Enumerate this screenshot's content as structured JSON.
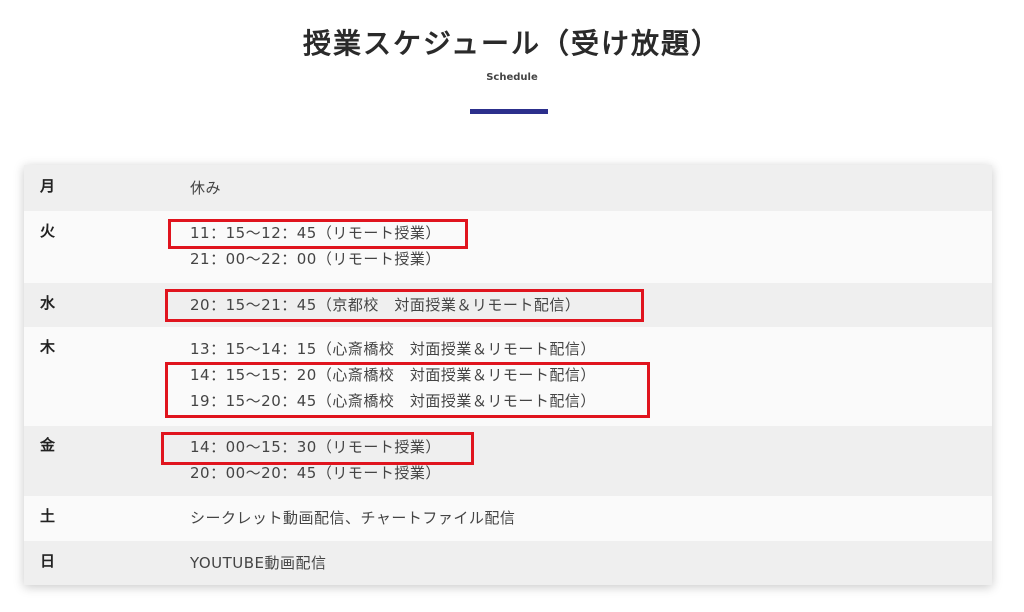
{
  "header": {
    "title": "授業スケジュール（受け放題）",
    "subtitle": "Schedule",
    "accent_color": "#2c2f8c",
    "highlight_color": "#e0141e"
  },
  "schedule": {
    "rows": [
      {
        "day": "月",
        "entries": [
          "休み"
        ],
        "highlighted": [
          false
        ]
      },
      {
        "day": "火",
        "entries": [
          "11：15〜12：45（リモート授業）",
          "21：00〜22：00（リモート授業）"
        ],
        "highlighted": [
          true,
          false
        ]
      },
      {
        "day": "水",
        "entries": [
          "20：15〜21：45（京都校　対面授業＆リモート配信）"
        ],
        "highlighted": [
          true
        ]
      },
      {
        "day": "木",
        "entries": [
          "13：15〜14：15（心斎橋校　対面授業＆リモート配信）",
          "14：15〜15：20（心斎橋校　対面授業＆リモート配信）",
          "19：15〜20：45（心斎橋校　対面授業＆リモート配信）"
        ],
        "highlighted": [
          false,
          true,
          true
        ]
      },
      {
        "day": "金",
        "entries": [
          "14：00〜15：30（リモート授業）",
          "20：00〜20：45（リモート授業）"
        ],
        "highlighted": [
          true,
          false
        ]
      },
      {
        "day": "土",
        "entries": [
          "シークレット動画配信、チャートファイル配信"
        ],
        "highlighted": [
          false
        ]
      },
      {
        "day": "日",
        "entries": [
          "YOUTUBE動画配信"
        ],
        "highlighted": [
          false
        ]
      }
    ]
  }
}
